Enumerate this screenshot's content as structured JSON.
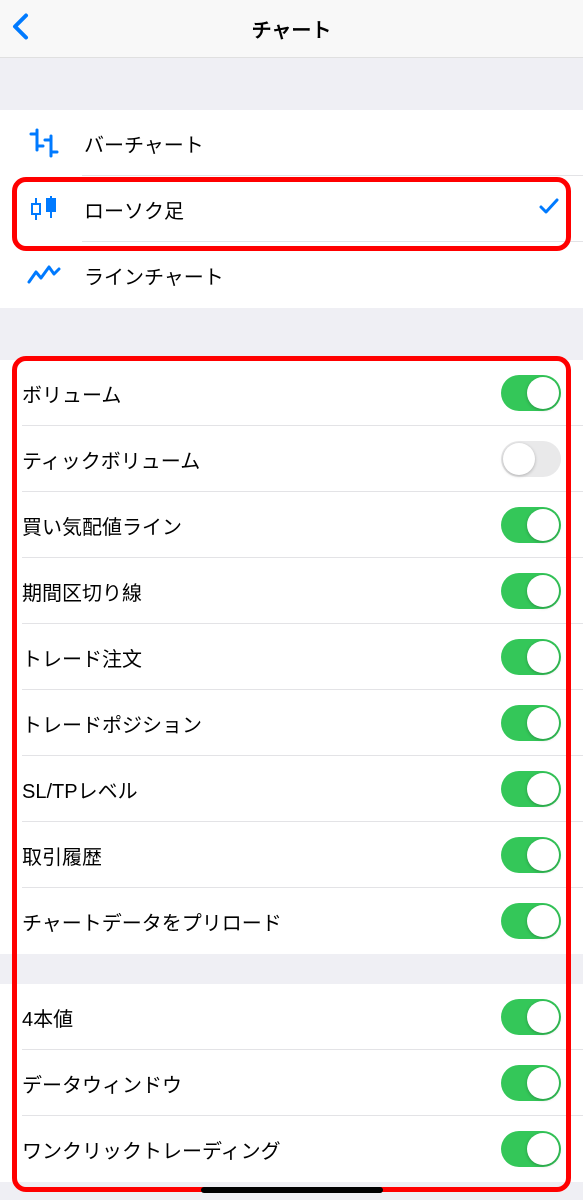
{
  "navbar": {
    "title": "チャート"
  },
  "chart_types": [
    {
      "label": "バーチャート",
      "selected": false
    },
    {
      "label": "ローソク足",
      "selected": true
    },
    {
      "label": "ラインチャート",
      "selected": false
    }
  ],
  "toggles_a": [
    {
      "label": "ボリューム",
      "on": true
    },
    {
      "label": "ティックボリューム",
      "on": false
    },
    {
      "label": "買い気配値ライン",
      "on": true
    },
    {
      "label": "期間区切り線",
      "on": true
    },
    {
      "label": "トレード注文",
      "on": true
    },
    {
      "label": "トレードポジション",
      "on": true
    },
    {
      "label": "SL/TPレベル",
      "on": true
    },
    {
      "label": "取引履歴",
      "on": true
    },
    {
      "label": "チャートデータをプリロード",
      "on": true
    }
  ],
  "toggles_b": [
    {
      "label": "4本値",
      "on": true
    },
    {
      "label": "データウィンドウ",
      "on": true
    },
    {
      "label": "ワンクリックトレーディング",
      "on": true
    }
  ]
}
